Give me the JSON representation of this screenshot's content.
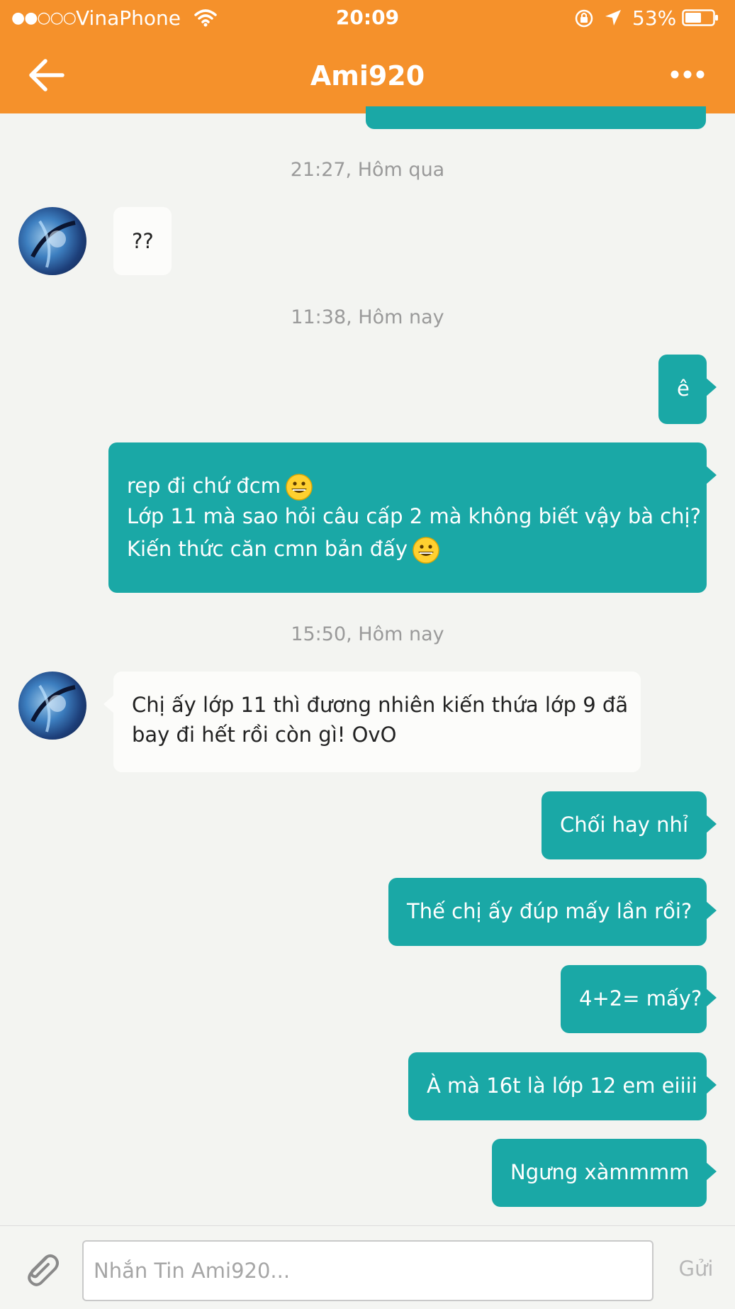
{
  "status_bar": {
    "signal": "●●○○○",
    "carrier": "VinaPhone",
    "time": "20:09",
    "battery_percent": "53%",
    "icons": [
      "wifi-icon",
      "rotation-lock-icon",
      "location-arrow-icon",
      "battery-icon"
    ]
  },
  "header": {
    "title": "Ami920",
    "back_icon": "arrow-left-icon",
    "more_icon": "more-dots-icon",
    "color": "#f5912b"
  },
  "conversation": {
    "timestamps": [
      "21:27, Hôm qua",
      "11:38, Hôm nay",
      "15:50, Hôm nay"
    ],
    "messages": [
      {
        "side": "in",
        "lines": [
          "??"
        ]
      },
      {
        "side": "out",
        "lines": [
          "ê"
        ]
      },
      {
        "side": "out",
        "lines": [
          "rep đi chứ đcm",
          "Lớp 11 mà sao hỏi câu cấp 2 mà không biết vậy bà chị?",
          "Kiến thức căn cmn bản đấy"
        ],
        "emoji": "grinning-face-emoji"
      },
      {
        "side": "in",
        "lines": [
          "Chị ấy lớp 11 thì đương nhiên kiến thứa lớp 9 đã",
          "bay đi hết rồi còn gì! OvO"
        ]
      },
      {
        "side": "out",
        "lines": [
          "Chối hay nhỉ"
        ]
      },
      {
        "side": "out",
        "lines": [
          "Thế chị ấy đúp mấy lần rồi?"
        ]
      },
      {
        "side": "out",
        "lines": [
          "4+2= mấy?"
        ]
      },
      {
        "side": "out",
        "lines": [
          "À mà 16t là lớp 12 em eiiii"
        ]
      },
      {
        "side": "out",
        "lines": [
          "Ngưng xàmmmm"
        ]
      }
    ],
    "colors": {
      "outgoing": "#1aa8a6",
      "incoming": "#fcfcfa"
    }
  },
  "composer": {
    "placeholder": "Nhắn Tin Ami920...",
    "value": "",
    "send_label": "Gửi",
    "attach_icon": "paperclip-icon"
  }
}
